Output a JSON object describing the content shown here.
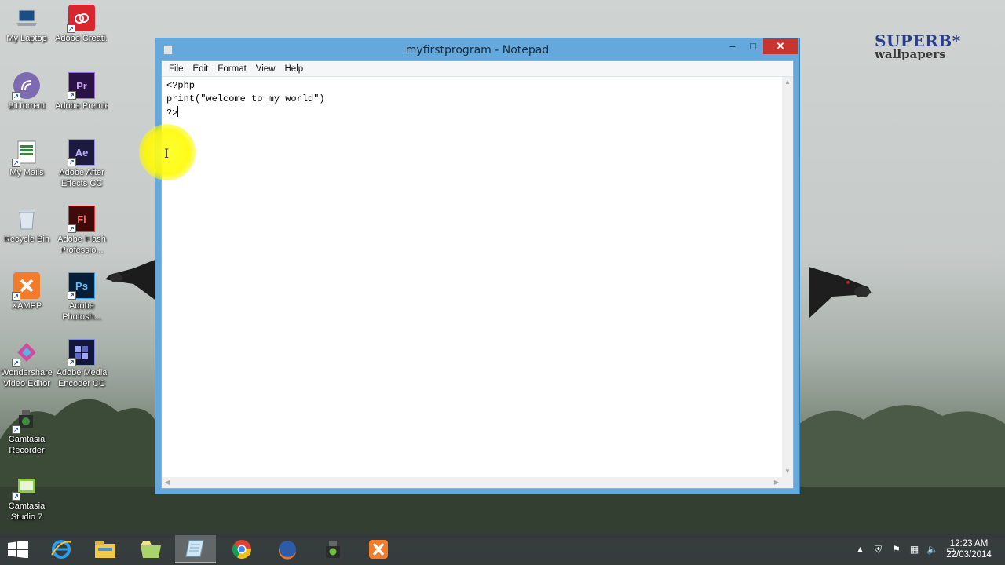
{
  "desktop": {
    "icons": [
      {
        "label": "My Laptop",
        "icon": "laptop-icon"
      },
      {
        "label": "Adobe Creati...",
        "icon": "adobe-creative-cloud-icon"
      },
      {
        "label": "BitTorrent",
        "icon": "bittorrent-icon"
      },
      {
        "label": "Adobe Premiere P...",
        "icon": "adobe-premiere-icon",
        "abbr": "Pr"
      },
      {
        "label": "My Mails",
        "icon": "spreadsheet-icon"
      },
      {
        "label": "Adobe After Effects CC",
        "icon": "adobe-after-effects-icon",
        "abbr": "Ae"
      },
      {
        "label": "Recycle Bin",
        "icon": "recycle-bin-icon"
      },
      {
        "label": "Adobe Flash Professio...",
        "icon": "adobe-flash-icon",
        "abbr": "Fl"
      },
      {
        "label": "XAMPP",
        "icon": "xampp-icon"
      },
      {
        "label": "Adobe Photosh...",
        "icon": "adobe-photoshop-icon",
        "abbr": "Ps"
      },
      {
        "label": "Wondershare Video Editor",
        "icon": "wondershare-icon"
      },
      {
        "label": "Adobe Media Encoder CC",
        "icon": "adobe-media-encoder-icon"
      },
      {
        "label": "Camtasia Recorder",
        "icon": "camtasia-recorder-icon"
      },
      {
        "label": "Camtasia Studio 7",
        "icon": "camtasia-studio-icon"
      }
    ]
  },
  "wallpaper": {
    "brand_line1": "SUPERB",
    "brand_mark": "*",
    "brand_line2": "wallpapers"
  },
  "notepad": {
    "title": "myfirstprogram - Notepad",
    "menu": [
      "File",
      "Edit",
      "Format",
      "View",
      "Help"
    ],
    "content_lines": [
      "<?php",
      "print(\"welcome to my world\")",
      "?>"
    ],
    "controls": {
      "minimize": "–",
      "maximize": "□",
      "close": "✕"
    }
  },
  "taskbar": {
    "items": [
      {
        "name": "internet-explorer"
      },
      {
        "name": "file-explorer"
      },
      {
        "name": "windows-store-folder"
      },
      {
        "name": "notepad",
        "active": true
      },
      {
        "name": "chrome"
      },
      {
        "name": "firefox"
      },
      {
        "name": "camtasia"
      },
      {
        "name": "xampp"
      }
    ],
    "clock": {
      "time": "12:23 AM",
      "date": "22/03/2014"
    }
  },
  "colors": {
    "title_bar": "#64a8dc",
    "close_button": "#c7352c",
    "taskbar": "#343a3c",
    "cursor_highlight": "#fff800"
  }
}
